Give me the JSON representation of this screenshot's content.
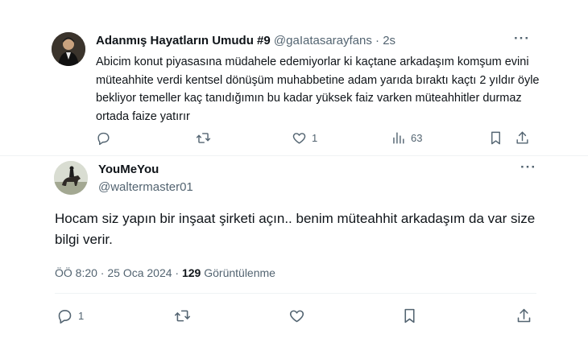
{
  "tweet1": {
    "author_name": "Adanmış Hayatların Umudu #9",
    "handle": "@gaIatasarayfans",
    "separator": "·",
    "time": "2s",
    "text": "Abicim konut piyasasına müdahele edemiyorlar ki kaçtane arkadaşım komşum evini müteahhite verdi kentsel dönüşüm muhabbetine adam yarıda bıraktı kaçtı 2 yıldır öyle bekliyor temeller kaç tanıdığımın bu kadar yüksek faiz varken müteahhitler durmaz ortada faize yatırır",
    "like_count": "1",
    "view_count": "63",
    "icons": [
      "reply-icon",
      "retweet-icon",
      "like-icon",
      "views-icon",
      "bookmark-icon",
      "share-icon"
    ]
  },
  "tweet2": {
    "author_name": "YouMeYou",
    "handle": "@waltermaster01",
    "text": "Hocam siz yapın bir inşaat şirketi açın.. benim müteahhit arkadaşım da var size bilgi verir.",
    "time": "ÖÖ 8:20 · 25 Oca 2024 · ",
    "views": "129",
    "views_label": " Görüntülenme",
    "reply_count": "1",
    "icons": [
      "reply-icon",
      "retweet-icon",
      "like-icon",
      "bookmark-icon",
      "share-icon"
    ]
  },
  "more_label": "···"
}
